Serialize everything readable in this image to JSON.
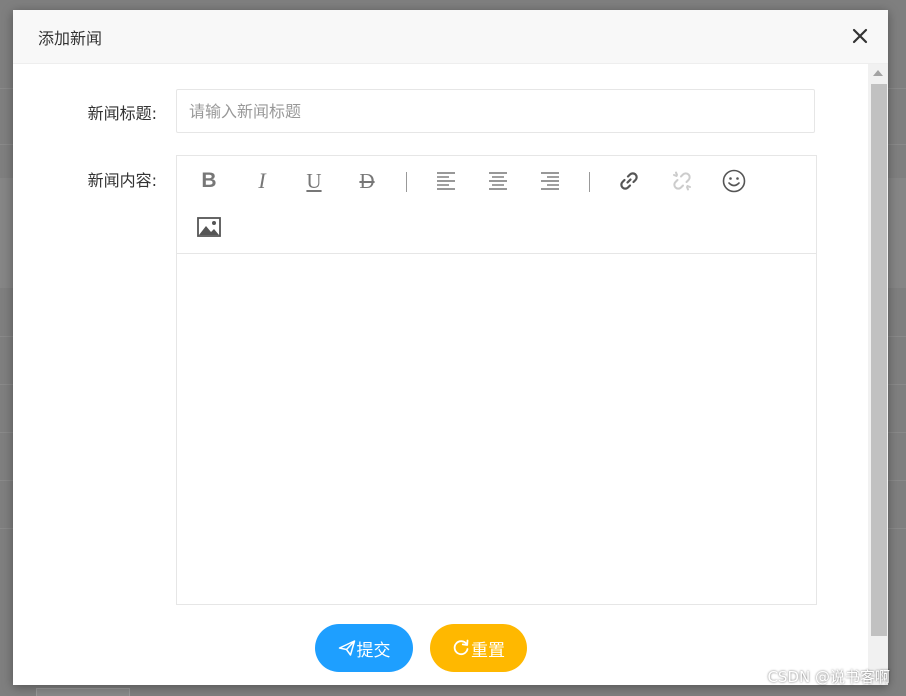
{
  "dialog": {
    "title": "添加新闻",
    "close_icon": "close-icon"
  },
  "form": {
    "title_label": "新闻标题:",
    "title_placeholder": "请输入新闻标题",
    "title_value": "",
    "content_label": "新闻内容:"
  },
  "editor": {
    "toolbar": [
      {
        "name": "bold",
        "glyph": "B",
        "icon": "bold-icon"
      },
      {
        "name": "italic",
        "glyph": "I",
        "icon": "italic-icon"
      },
      {
        "name": "underline",
        "glyph": "U",
        "icon": "underline-icon"
      },
      {
        "name": "strikethrough",
        "glyph": "D",
        "icon": "strikethrough-icon"
      },
      {
        "name": "align-left",
        "icon": "align-left-icon"
      },
      {
        "name": "align-center",
        "icon": "align-center-icon"
      },
      {
        "name": "align-right",
        "icon": "align-right-icon"
      },
      {
        "name": "link",
        "icon": "link-icon"
      },
      {
        "name": "unlink",
        "icon": "unlink-icon",
        "disabled": true
      },
      {
        "name": "emoji",
        "icon": "smiley-icon"
      },
      {
        "name": "image",
        "icon": "image-icon"
      }
    ],
    "content": ""
  },
  "buttons": {
    "submit_label": "提交",
    "submit_icon": "send-icon",
    "reset_label": "重置",
    "reset_icon": "refresh-icon"
  },
  "colors": {
    "submit": "#1e9fff",
    "reset": "#ffb800",
    "overlay": "#7f7f7f"
  },
  "watermark": "CSDN @说书客啊"
}
